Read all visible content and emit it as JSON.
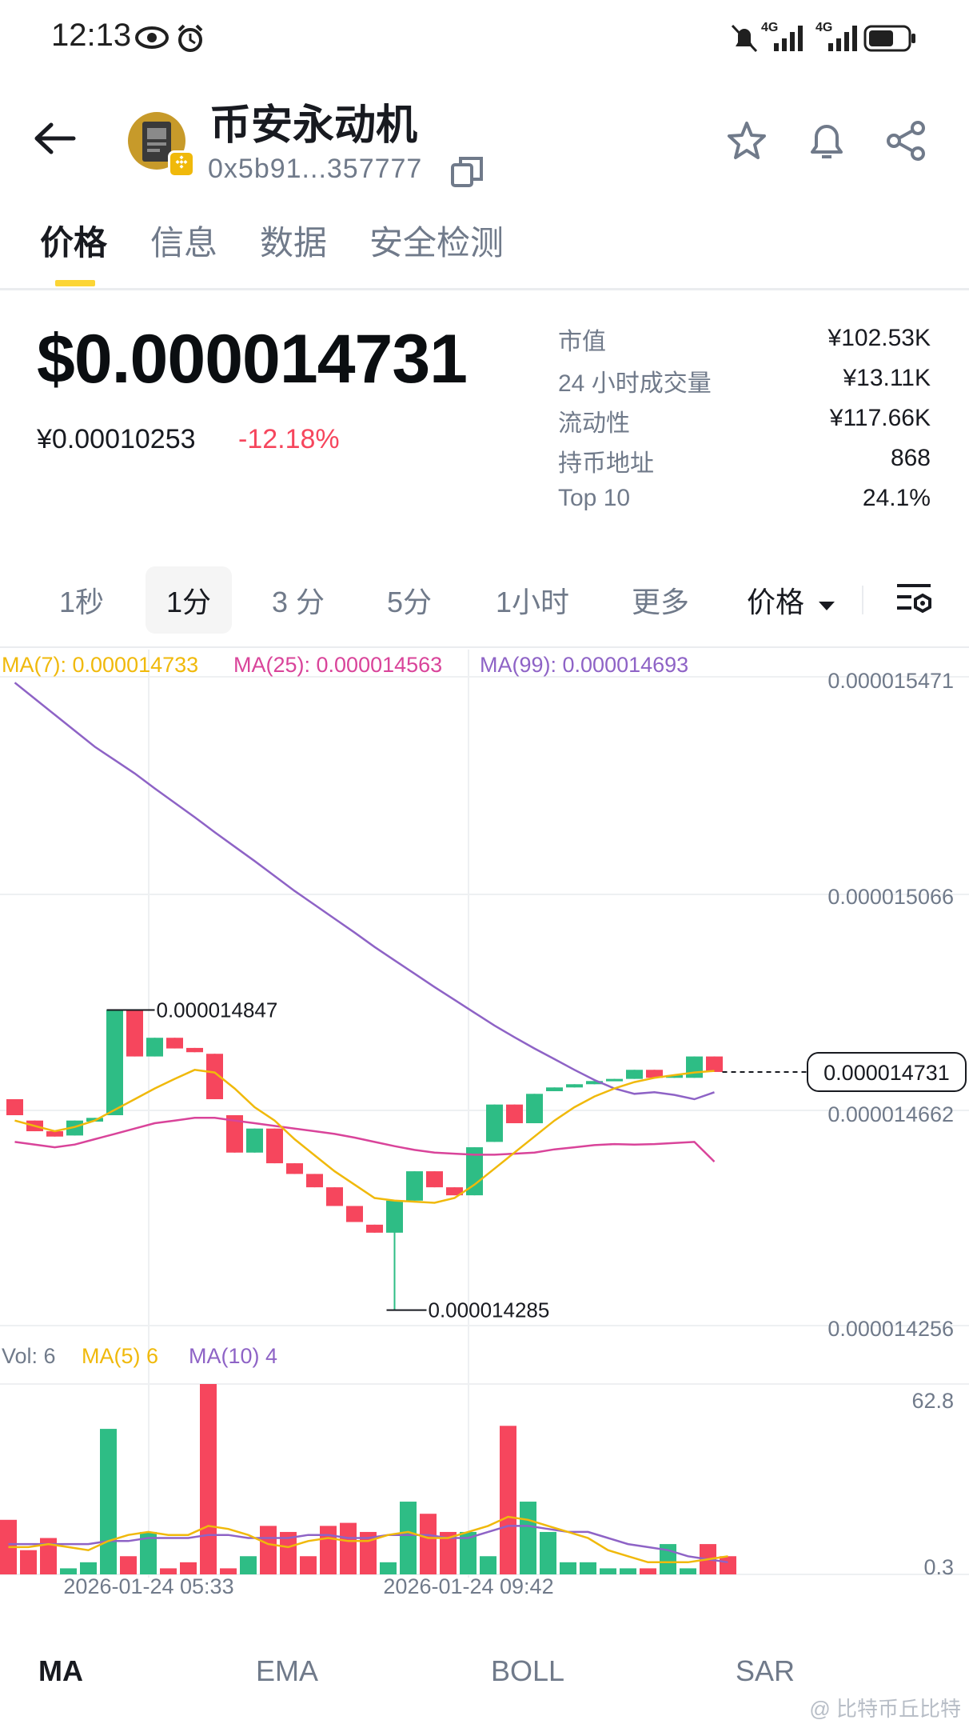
{
  "status_bar": {
    "time": "12:13",
    "signal_1": "4G",
    "signal_2": "4G"
  },
  "header": {
    "token_name": "币安永动机",
    "token_address": "0x5b91...357777",
    "icons": [
      "back-arrow-icon",
      "copy-icon",
      "star-icon",
      "bell-icon",
      "share-icon"
    ]
  },
  "tabs": [
    {
      "label": "价格",
      "active": true
    },
    {
      "label": "信息",
      "active": false
    },
    {
      "label": "数据",
      "active": false
    },
    {
      "label": "安全检测",
      "active": false
    }
  ],
  "price": {
    "usd": "$0.000014731",
    "cny": "¥0.00010253",
    "change": "-12.18%"
  },
  "stats": [
    {
      "label": "市值",
      "value": "¥102.53K"
    },
    {
      "label": "24 小时成交量",
      "value": "¥13.11K"
    },
    {
      "label": "流动性",
      "value": "¥117.66K"
    },
    {
      "label": "持币地址",
      "value": "868"
    },
    {
      "label": "Top 10",
      "value": "24.1%"
    }
  ],
  "intervals": [
    {
      "label": "1秒",
      "active": false
    },
    {
      "label": "1分",
      "active": true
    },
    {
      "label": "3 分",
      "active": false
    },
    {
      "label": "5分",
      "active": false
    },
    {
      "label": "1小时",
      "active": false
    },
    {
      "label": "更多",
      "active": false
    }
  ],
  "price_dropdown": "价格",
  "ma_legend": {
    "ma7": "MA(7): 0.000014733",
    "ma25": "MA(25): 0.000014563",
    "ma99": "MA(99): 0.000014693"
  },
  "vol_legend": {
    "vol": "Vol: 6",
    "ma5": "MA(5) 6",
    "ma10": "MA(10) 4"
  },
  "colors": {
    "up": "#2ebd85",
    "down": "#f6465d",
    "ma7": "#f0b90b",
    "ma25": "#d9449a",
    "ma99": "#8e63c6",
    "accent": "#fcd535"
  },
  "chart_data": {
    "type": "candlestick",
    "price_axis_labels": [
      "0.000015471",
      "0.000015066",
      "0.000014662",
      "0.000014256"
    ],
    "ylim": [
      1.4256e-05,
      1.5471e-05
    ],
    "current_price_label": "0.000014731",
    "high_label": "0.000014847",
    "low_label": "0.000014285",
    "x_labels": [
      "2026-01-24 05:33",
      "2026-01-24 09:42"
    ],
    "candles": [
      {
        "o": 1.468e-05,
        "c": 1.465e-05,
        "h": 1.468e-05,
        "l": 1.465e-05
      },
      {
        "o": 1.464e-05,
        "c": 1.462e-05,
        "h": 1.464e-05,
        "l": 1.462e-05
      },
      {
        "o": 1.462e-05,
        "c": 1.461e-05,
        "h": 1.462e-05,
        "l": 1.461e-05
      },
      {
        "o": 1.4612e-05,
        "c": 1.464e-05,
        "h": 1.464e-05,
        "l": 1.4612e-05
      },
      {
        "o": 1.4638e-05,
        "c": 1.4645e-05,
        "h": 1.4645e-05,
        "l": 1.4638e-05
      },
      {
        "o": 1.465e-05,
        "c": 1.4847e-05,
        "h": 1.4847e-05,
        "l": 1.465e-05
      },
      {
        "o": 1.4847e-05,
        "c": 1.476e-05,
        "h": 1.4847e-05,
        "l": 1.476e-05
      },
      {
        "o": 1.476e-05,
        "c": 1.4795e-05,
        "h": 1.4795e-05,
        "l": 1.476e-05
      },
      {
        "o": 1.4795e-05,
        "c": 1.4775e-05,
        "h": 1.4795e-05,
        "l": 1.4775e-05
      },
      {
        "o": 1.4776e-05,
        "c": 1.4768e-05,
        "h": 1.4776e-05,
        "l": 1.4768e-05
      },
      {
        "o": 1.4765e-05,
        "c": 1.468e-05,
        "h": 1.4765e-05,
        "l": 1.468e-05
      },
      {
        "o": 1.465e-05,
        "c": 1.458e-05,
        "h": 1.465e-05,
        "l": 1.458e-05
      },
      {
        "o": 1.458e-05,
        "c": 1.4625e-05,
        "h": 1.4625e-05,
        "l": 1.458e-05
      },
      {
        "o": 1.4625e-05,
        "c": 1.456e-05,
        "h": 1.4625e-05,
        "l": 1.456e-05
      },
      {
        "o": 1.456e-05,
        "c": 1.454e-05,
        "h": 1.456e-05,
        "l": 1.454e-05
      },
      {
        "o": 1.454e-05,
        "c": 1.4515e-05,
        "h": 1.454e-05,
        "l": 1.4515e-05
      },
      {
        "o": 1.4515e-05,
        "c": 1.448e-05,
        "h": 1.4515e-05,
        "l": 1.448e-05
      },
      {
        "o": 1.448e-05,
        "c": 1.445e-05,
        "h": 1.448e-05,
        "l": 1.445e-05
      },
      {
        "o": 1.4445e-05,
        "c": 1.443e-05,
        "h": 1.4445e-05,
        "l": 1.443e-05
      },
      {
        "o": 1.443e-05,
        "c": 1.449e-05,
        "h": 1.449e-05,
        "l": 1.4285e-05
      },
      {
        "o": 1.449e-05,
        "c": 1.4545e-05,
        "h": 1.4545e-05,
        "l": 1.449e-05
      },
      {
        "o": 1.4545e-05,
        "c": 1.4515e-05,
        "h": 1.4545e-05,
        "l": 1.4515e-05
      },
      {
        "o": 1.4515e-05,
        "c": 1.45e-05,
        "h": 1.4515e-05,
        "l": 1.45e-05
      },
      {
        "o": 1.45e-05,
        "c": 1.459e-05,
        "h": 1.459e-05,
        "l": 1.45e-05
      },
      {
        "o": 1.46e-05,
        "c": 1.467e-05,
        "h": 1.467e-05,
        "l": 1.46e-05
      },
      {
        "o": 1.467e-05,
        "c": 1.4635e-05,
        "h": 1.467e-05,
        "l": 1.4635e-05
      },
      {
        "o": 1.4635e-05,
        "c": 1.469e-05,
        "h": 1.469e-05,
        "l": 1.4635e-05
      },
      {
        "o": 1.4695e-05,
        "c": 1.4702e-05,
        "h": 1.4702e-05,
        "l": 1.4695e-05
      },
      {
        "o": 1.4702e-05,
        "c": 1.4708e-05,
        "h": 1.4708e-05,
        "l": 1.4702e-05
      },
      {
        "o": 1.4708e-05,
        "c": 1.4714e-05,
        "h": 1.4714e-05,
        "l": 1.4708e-05
      },
      {
        "o": 1.4714e-05,
        "c": 1.4718e-05,
        "h": 1.4718e-05,
        "l": 1.4714e-05
      },
      {
        "o": 1.4718e-05,
        "c": 1.4735e-05,
        "h": 1.4735e-05,
        "l": 1.4718e-05
      },
      {
        "o": 1.4735e-05,
        "c": 1.472e-05,
        "h": 1.4735e-05,
        "l": 1.472e-05
      },
      {
        "o": 1.472e-05,
        "c": 1.4725e-05,
        "h": 1.4725e-05,
        "l": 1.472e-05
      },
      {
        "o": 1.472e-05,
        "c": 1.476e-05,
        "h": 1.476e-05,
        "l": 1.472e-05
      },
      {
        "o": 1.476e-05,
        "c": 1.4731e-05,
        "h": 1.476e-05,
        "l": 1.4731e-05
      }
    ],
    "ma7": [
      1.464e-05,
      1.463e-05,
      1.462e-05,
      1.4628e-05,
      1.464e-05,
      1.466e-05,
      1.468e-05,
      1.47e-05,
      1.4718e-05,
      1.4735e-05,
      1.473e-05,
      1.47e-05,
      1.4665e-05,
      1.464e-05,
      1.4605e-05,
      1.4575e-05,
      1.4545e-05,
      1.452e-05,
      1.4495e-05,
      1.449e-05,
      1.4488e-05,
      1.4486e-05,
      1.4495e-05,
      1.452e-05,
      1.455e-05,
      1.458e-05,
      1.461e-05,
      1.464e-05,
      1.4665e-05,
      1.4685e-05,
      1.47e-05,
      1.4712e-05,
      1.472e-05,
      1.4725e-05,
      1.473e-05,
      1.4733e-05
    ],
    "ma25": [
      1.46e-05,
      1.4595e-05,
      1.459e-05,
      1.4595e-05,
      1.4605e-05,
      1.4615e-05,
      1.4625e-05,
      1.4635e-05,
      1.464e-05,
      1.4645e-05,
      1.4645e-05,
      1.464e-05,
      1.4635e-05,
      1.463e-05,
      1.4625e-05,
      1.462e-05,
      1.4615e-05,
      1.4608e-05,
      1.46e-05,
      1.4592e-05,
      1.4585e-05,
      1.458e-05,
      1.4578e-05,
      1.4576e-05,
      1.4576e-05,
      1.4578e-05,
      1.458e-05,
      1.4586e-05,
      1.459e-05,
      1.4594e-05,
      1.4596e-05,
      1.4595e-05,
      1.4596e-05,
      1.4598e-05,
      1.46e-05,
      1.4563e-05
    ],
    "ma99": [
      1.546e-05,
      1.543e-05,
      1.54e-05,
      1.537e-05,
      1.534e-05,
      1.5315e-05,
      1.529e-05,
      1.5262e-05,
      1.5235e-05,
      1.5208e-05,
      1.518e-05,
      1.5153e-05,
      1.5126e-05,
      1.5098e-05,
      1.507e-05,
      1.5044e-05,
      1.5018e-05,
      1.4992e-05,
      1.4965e-05,
      1.494e-05,
      1.4915e-05,
      1.489e-05,
      1.4866e-05,
      1.4842e-05,
      1.4818e-05,
      1.4796e-05,
      1.4775e-05,
      1.4755e-05,
      1.4735e-05,
      1.4716e-05,
      1.47e-05,
      1.469e-05,
      1.4693e-05,
      1.4688e-05,
      1.468e-05,
      1.4693e-05
    ],
    "volume_axis_labels": [
      "62.8",
      "0.3"
    ],
    "volume_ylim": [
      0,
      62.8
    ],
    "volumes": [
      18,
      8,
      12,
      2,
      4,
      48,
      6,
      14,
      2,
      4,
      62.8,
      2,
      6,
      16,
      14,
      6,
      16,
      17,
      14,
      4,
      24,
      20,
      14,
      14,
      6,
      49,
      24,
      14,
      4,
      4,
      2,
      2,
      2,
      10,
      2,
      10,
      6
    ],
    "vol_ma5": [
      9,
      9,
      10,
      9,
      8,
      11,
      13,
      14,
      13,
      13,
      16,
      15,
      13,
      10,
      9,
      11,
      12,
      11,
      11,
      13,
      14,
      12,
      12,
      14,
      16,
      19,
      18,
      16,
      14,
      12,
      8,
      6,
      4,
      4,
      4,
      5,
      6
    ],
    "vol_ma10": [
      10,
      10,
      10,
      10,
      10,
      11,
      11,
      12,
      12,
      12,
      13,
      13,
      12,
      12,
      12,
      13,
      13,
      12,
      12,
      13,
      13,
      13,
      12,
      12,
      14,
      16,
      16,
      15,
      14,
      14,
      12,
      10,
      9,
      8,
      6,
      5,
      4
    ]
  },
  "indicator_tabs": [
    {
      "label": "MA",
      "active": true
    },
    {
      "label": "EMA",
      "active": false
    },
    {
      "label": "BOLL",
      "active": false
    },
    {
      "label": "SAR",
      "active": false
    }
  ],
  "watermark": "@ 比特币丘比特"
}
